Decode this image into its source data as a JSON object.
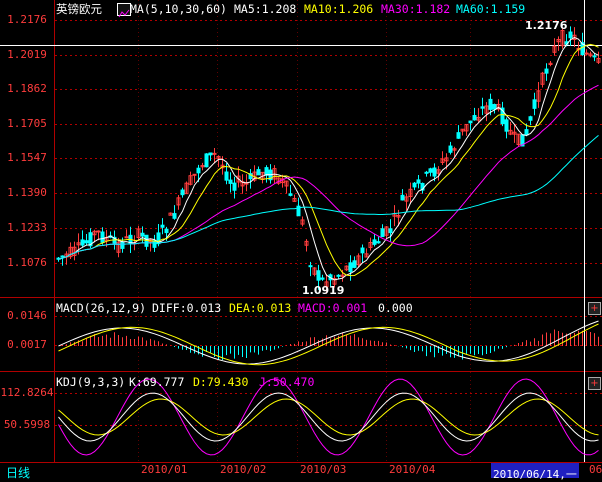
{
  "main_header": {
    "symbol": "英镑欧元",
    "ma_label": "MA(5,10,30,60)",
    "ma5": "MA5:1.208",
    "ma10": "MA10:1.206",
    "ma30": "MA30:1.182",
    "ma60": "MA60:1.159"
  },
  "price_axis": [
    "1.2176",
    "1.2019",
    "1.1862",
    "1.1705",
    "1.1547",
    "1.1390",
    "1.1233",
    "1.1076"
  ],
  "price_annotations": {
    "high": "1.2176",
    "low": "1.0919"
  },
  "macd_header": {
    "label": "MACD(26,12,9)",
    "diff": "DIFF:0.013",
    "dea": "DEA:0.013",
    "macd": "MACD:0.001",
    "value": "0.000"
  },
  "macd_axis": [
    "0.0146",
    "0.0017"
  ],
  "kdj_header": {
    "label": "KDJ(9,3,3)",
    "k": "K:69.777",
    "d": "D:79.430",
    "j": "J:50.470"
  },
  "kdj_axis": [
    "112.8264",
    "50.5998"
  ],
  "footer": {
    "period": "日线",
    "months": [
      "2010/01",
      "2010/02",
      "2010/03",
      "2010/04"
    ],
    "cursor_date": "2010/06/14,一",
    "last_tick": "06"
  },
  "colors": {
    "up": "#ff3c3c",
    "down": "#00ffff",
    "ma5": "#ffffff",
    "ma10": "#ffff00",
    "ma30": "#ff00ff",
    "ma60": "#00ffff",
    "frame": "#c00000"
  },
  "icons": [
    "plus-icon",
    "plus-icon",
    "ma-chart-icon"
  ]
}
